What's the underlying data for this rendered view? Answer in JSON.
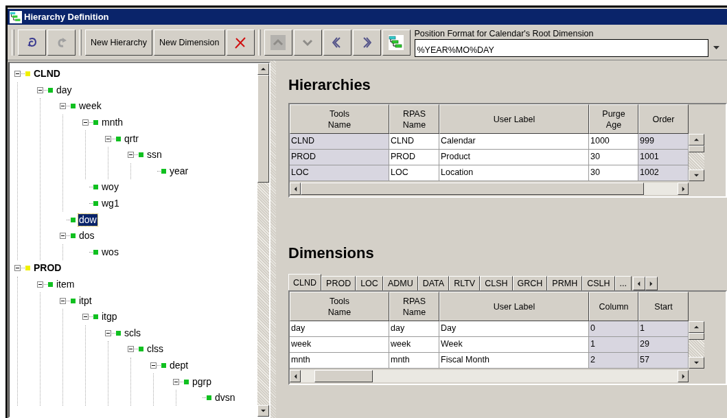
{
  "window": {
    "title": "Hierarchy Definition"
  },
  "toolbar": [
    {
      "kind": "swirl",
      "disabled": false
    },
    {
      "kind": "redo",
      "disabled": true
    },
    {
      "kind": "text",
      "label": "New Hierarchy",
      "disabled": false
    },
    {
      "kind": "text",
      "label": "New Dimension",
      "disabled": false
    },
    {
      "kind": "delete",
      "disabled": false
    },
    {
      "kind": "up",
      "disabled": true
    },
    {
      "kind": "down",
      "disabled": true
    },
    {
      "kind": "left",
      "disabled": false
    },
    {
      "kind": "right",
      "disabled": false
    },
    {
      "kind": "tree",
      "disabled": false
    }
  ],
  "position_format": {
    "label": "Position Format for Calendar's Root Dimension",
    "value": "%YEAR%MO%DAY"
  },
  "tree": [
    {
      "label": "CLND",
      "kind": "root",
      "selected": false,
      "children": [
        {
          "label": "day",
          "kind": "dim",
          "selected": false,
          "children": [
            {
              "label": "week",
              "kind": "dim",
              "selected": false,
              "children": [
                {
                  "label": "mnth",
                  "kind": "dim",
                  "selected": false,
                  "children": [
                    {
                      "label": "qrtr",
                      "kind": "dim",
                      "selected": false,
                      "children": [
                        {
                          "label": "ssn",
                          "kind": "dim",
                          "selected": false,
                          "children": [
                            {
                              "label": "year",
                              "kind": "dim",
                              "selected": false
                            }
                          ]
                        }
                      ]
                    }
                  ]
                },
                {
                  "label": "woy",
                  "kind": "dim",
                  "selected": false
                },
                {
                  "label": "wg1",
                  "kind": "dim",
                  "selected": false
                }
              ]
            },
            {
              "label": "dow",
              "kind": "dim",
              "selected": true
            },
            {
              "label": "dos",
              "kind": "dim",
              "selected": false,
              "children": [
                {
                  "label": "wos",
                  "kind": "dim",
                  "selected": false
                }
              ]
            }
          ]
        }
      ]
    },
    {
      "label": "PROD",
      "kind": "root",
      "selected": false,
      "children": [
        {
          "label": "item",
          "kind": "dim",
          "selected": false,
          "children": [
            {
              "label": "itpt",
              "kind": "dim",
              "selected": false,
              "children": [
                {
                  "label": "itgp",
                  "kind": "dim",
                  "selected": false,
                  "children": [
                    {
                      "label": "scls",
                      "kind": "dim",
                      "selected": false,
                      "children": [
                        {
                          "label": "clss",
                          "kind": "dim",
                          "selected": false,
                          "children": [
                            {
                              "label": "dept",
                              "kind": "dim",
                              "selected": false,
                              "children": [
                                {
                                  "label": "pgrp",
                                  "kind": "dim",
                                  "selected": false,
                                  "children": [
                                    {
                                      "label": "dvsn",
                                      "kind": "dim",
                                      "selected": false
                                    }
                                  ]
                                }
                              ]
                            }
                          ]
                        }
                      ]
                    }
                  ]
                }
              ]
            }
          ]
        }
      ]
    }
  ],
  "hierarchies": {
    "title": "Hierarchies",
    "columns": [
      {
        "label": "Tools\nName",
        "readonly": true
      },
      {
        "label": "RPAS\nName",
        "readonly": false
      },
      {
        "label": "User Label",
        "readonly": false
      },
      {
        "label": "Purge\nAge",
        "readonly": false
      },
      {
        "label": "Order",
        "readonly": true
      }
    ],
    "rows": [
      [
        "CLND",
        "CLND",
        "Calendar",
        "1000",
        "999"
      ],
      [
        "PROD",
        "PROD",
        "Product",
        "30",
        "1001"
      ],
      [
        "LOC",
        "LOC",
        "Location",
        "30",
        "1002"
      ]
    ]
  },
  "dimensions": {
    "title": "Dimensions",
    "tabs": [
      {
        "label": "CLND",
        "selected": true
      },
      {
        "label": "PROD",
        "selected": false
      },
      {
        "label": "LOC",
        "selected": false
      },
      {
        "label": "ADMU",
        "selected": false
      },
      {
        "label": "DATA",
        "selected": false
      },
      {
        "label": "RLTV",
        "selected": false
      },
      {
        "label": "CLSH",
        "selected": false
      },
      {
        "label": "GRCH",
        "selected": false
      },
      {
        "label": "PRMH",
        "selected": false
      },
      {
        "label": "CSLH",
        "selected": false
      },
      {
        "label": "...",
        "selected": false
      }
    ],
    "columns": [
      {
        "label": "Tools\nName",
        "readonly": false
      },
      {
        "label": "RPAS\nName",
        "readonly": false
      },
      {
        "label": "User Label",
        "readonly": false
      },
      {
        "label": "Column",
        "readonly": true
      },
      {
        "label": "Start",
        "readonly": true
      }
    ],
    "rows": [
      [
        "day",
        "day",
        "Day",
        "0",
        "1"
      ],
      [
        "week",
        "week",
        "Week",
        "1",
        "29"
      ],
      [
        "mnth",
        "mnth",
        "Fiscal Month",
        "2",
        "57"
      ]
    ]
  }
}
